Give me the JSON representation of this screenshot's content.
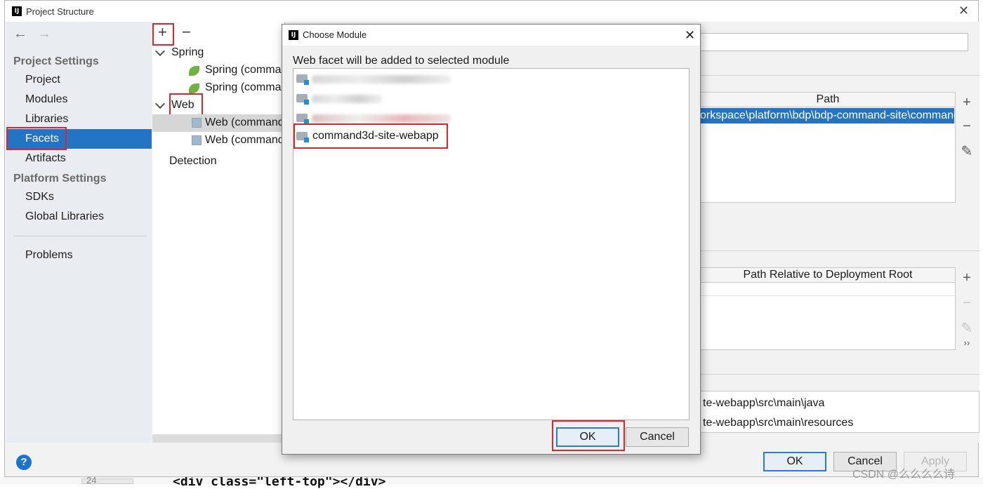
{
  "window": {
    "title": "Project Structure",
    "logo": "IJ"
  },
  "nav": {
    "back_icon": "←",
    "forward_icon": "→"
  },
  "sidebar": {
    "project_settings": "Project Settings",
    "items_project": [
      "Project",
      "Modules",
      "Libraries",
      "Facets",
      "Artifacts"
    ],
    "platform_settings": "Platform Settings",
    "items_platform": [
      "SDKs",
      "Global Libraries"
    ],
    "problems": "Problems",
    "selected": "Facets"
  },
  "tree": {
    "add": "+",
    "remove": "−",
    "spring_group": "Spring",
    "spring_items": [
      "Spring (comman",
      "Spring (comman"
    ],
    "web_group": "Web",
    "web_items": [
      "Web (command",
      "Web (command"
    ],
    "detection": "Detection"
  },
  "right_panel": {
    "path_header": "Path",
    "path_value": "orkspace\\platform\\bdp\\bdp-command-site\\command-",
    "relative_header": "Path Relative to Deployment Root",
    "source_roots": [
      "te-webapp\\src\\main\\java",
      "te-webapp\\src\\main\\resources"
    ],
    "tools": {
      "add": "+",
      "remove": "−",
      "edit": "✎",
      "more": "››"
    }
  },
  "footer": {
    "ok": "OK",
    "cancel": "Cancel",
    "apply": "Apply",
    "help": "?"
  },
  "dialog": {
    "title": "Choose Module",
    "logo": "IJ",
    "close": "✕",
    "prompt": "Web facet will be added to selected module",
    "modules_blurred": 3,
    "selected_module": "command3d-site-webapp",
    "ok": "OK",
    "cancel": "Cancel"
  },
  "background_code": {
    "line_number": "24",
    "code": "<div class=\"left-top\"></div>"
  },
  "watermark": "CSDN @么么么么诗",
  "colors": {
    "selection": "#2474c6",
    "highlight_box": "#e0262c",
    "primary_border": "#2a7bd4"
  }
}
